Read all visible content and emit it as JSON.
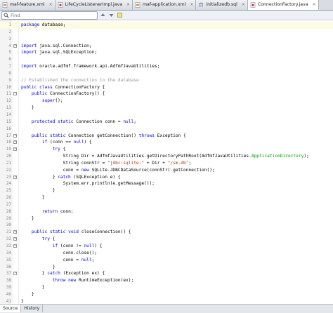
{
  "tabs": [
    {
      "label": "maf-feature.xml",
      "icon": "xml-file-icon",
      "active": false
    },
    {
      "label": "LifeCycleListenerImpl.java",
      "icon": "java-file-icon",
      "active": false
    },
    {
      "label": "maf-application.xml",
      "icon": "xml-file-icon",
      "active": false
    },
    {
      "label": "initializedb.sql",
      "icon": "sql-file-icon",
      "active": false
    },
    {
      "label": "ConnectionFactory.java",
      "icon": "java-file-icon",
      "active": true
    }
  ],
  "search": {
    "placeholder": "Find"
  },
  "code_lines": [
    {
      "n": "1",
      "text": "package database;",
      "hl": true
    },
    {
      "n": "2",
      "text": ""
    },
    {
      "n": "3",
      "text": ""
    },
    {
      "n": "4",
      "text": "import java.sql.Connection;",
      "fold": true
    },
    {
      "n": "5",
      "text": "import java.sql.SQLException;"
    },
    {
      "n": "6",
      "text": ""
    },
    {
      "n": "7",
      "text": "import oracle.adfmf.framework.api.AdfmfJavaUtilities;"
    },
    {
      "n": "8",
      "text": ""
    },
    {
      "n": "9",
      "text": "// Established the connection to the database",
      "comment": true
    },
    {
      "n": "10",
      "text": "public class ConnectionFactory {"
    },
    {
      "n": "11",
      "text": "    public ConnectionFactory() {",
      "fold": true
    },
    {
      "n": "12",
      "text": "        super();"
    },
    {
      "n": "13",
      "text": "    }"
    },
    {
      "n": "14",
      "text": ""
    },
    {
      "n": "15",
      "text": "    protected static Connection conn = null;"
    },
    {
      "n": "16",
      "text": ""
    },
    {
      "n": "17",
      "text": "    public static Connection getConnection() throws Exception {",
      "fold": true
    },
    {
      "n": "18",
      "text": "        if (conn == null) {",
      "fold": true
    },
    {
      "n": "19",
      "text": "            try {",
      "fold": true
    },
    {
      "n": "20",
      "text": "                String Dir = AdfmfJavaUtilities.getDirectoryPathRoot(AdfmfJavaUtilities.ApplicationDirectory);"
    },
    {
      "n": "21",
      "text": "                String connStr = \"jdbc:sqlite:\" + Dir + \"/sm.db\";"
    },
    {
      "n": "22",
      "text": "                conn = new SQLite.JDBCDataSource(connStr).getConnection();"
    },
    {
      "n": "23",
      "text": "            } catch (SQLException e) {",
      "fold": true
    },
    {
      "n": "24",
      "text": "                System.err.println(e.getMessage());"
    },
    {
      "n": "25",
      "text": "            }"
    },
    {
      "n": "26",
      "text": "        }"
    },
    {
      "n": "27",
      "text": ""
    },
    {
      "n": "28",
      "text": "        return conn;"
    },
    {
      "n": "29",
      "text": "    }"
    },
    {
      "n": "30",
      "text": ""
    },
    {
      "n": "31",
      "text": "    public static void closeConnection() {",
      "fold": true
    },
    {
      "n": "32",
      "text": "        try {",
      "fold": true
    },
    {
      "n": "33",
      "text": "            if (conn != null) {",
      "fold": true
    },
    {
      "n": "34",
      "text": "                conn.close();"
    },
    {
      "n": "35",
      "text": "                conn = null;"
    },
    {
      "n": "36",
      "text": "            }"
    },
    {
      "n": "37",
      "text": "        } catch (Exception ex) {",
      "fold": true
    },
    {
      "n": "38",
      "text": "            throw new RuntimeException(ex);"
    },
    {
      "n": "39",
      "text": "        }"
    },
    {
      "n": "40",
      "text": "    }"
    },
    {
      "n": "41",
      "text": "}"
    }
  ],
  "bottom_tabs": [
    {
      "label": "Source",
      "active": true
    },
    {
      "label": "History",
      "active": false
    }
  ],
  "colors": {
    "keyword": "#0000e6",
    "string": "#a33c1c",
    "comment": "#969696",
    "field": "#009900"
  }
}
